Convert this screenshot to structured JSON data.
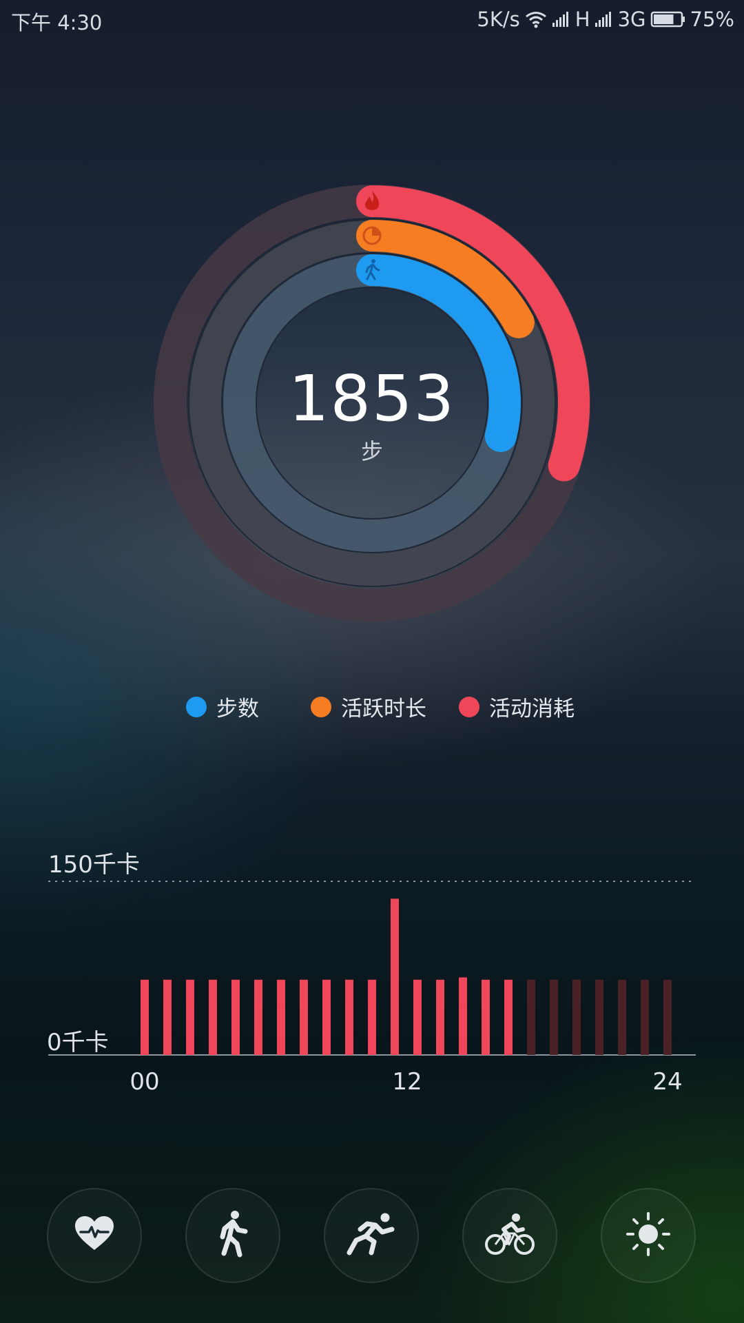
{
  "status_bar": {
    "time": "下午 4:30",
    "net_speed": "5K/s",
    "signal1_type": "H",
    "signal2_type": "3G",
    "battery_percent": "75%",
    "battery_level": 0.75,
    "icons": [
      "wifi-icon",
      "signal-icon",
      "signal-icon",
      "battery-icon"
    ]
  },
  "summary": {
    "steps_value": "1853",
    "steps_unit": "步",
    "ring_progress": {
      "steps": 0.29,
      "active_time": 0.17,
      "calories": 0.3
    },
    "ring_icons": {
      "steps": "walking-icon",
      "active_time": "pie-clock-icon",
      "calories": "flame-icon"
    },
    "colors": {
      "steps": "#1e9bf0",
      "active_time": "#f67d22",
      "calories": "#f0465a"
    }
  },
  "legend": [
    {
      "label": "步数",
      "color": "#1e9bf0"
    },
    {
      "label": "活跃时长",
      "color": "#f67d22"
    },
    {
      "label": "活动消耗",
      "color": "#f0465a"
    }
  ],
  "chart": {
    "max_label": "150千卡",
    "min_label": "0千卡",
    "x_ticks": [
      "00",
      "12",
      "24"
    ]
  },
  "chart_data": {
    "type": "bar",
    "ylim": [
      0,
      150
    ],
    "categories": [
      "0",
      "1",
      "2",
      "3",
      "4",
      "5",
      "6",
      "7",
      "8",
      "9",
      "10",
      "11",
      "12",
      "13",
      "14",
      "15",
      "16",
      "17",
      "18",
      "19",
      "20",
      "21",
      "22",
      "23"
    ],
    "values": [
      65,
      65,
      65,
      65,
      65,
      65,
      65,
      65,
      65,
      65,
      65,
      135,
      65,
      65,
      67,
      65,
      65,
      65,
      65,
      65,
      65,
      65,
      65,
      65
    ],
    "future_from_index": 17,
    "colors": {
      "past": "#f0465a",
      "future": "#4a2226"
    }
  },
  "bottom_nav": [
    "heart-rate-icon",
    "walking-icon",
    "running-icon",
    "cycling-icon",
    "sleep-sun-icon"
  ]
}
